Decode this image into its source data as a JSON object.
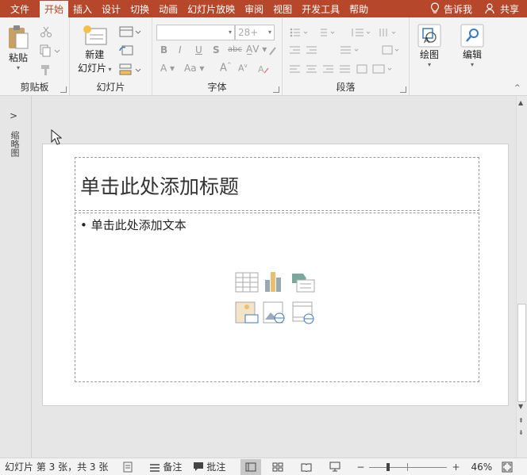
{
  "tabs": [
    {
      "label": "文件",
      "active": false
    },
    {
      "label": "开始",
      "active": true
    },
    {
      "label": "插入",
      "active": false
    },
    {
      "label": "设计",
      "active": false
    },
    {
      "label": "切换",
      "active": false
    },
    {
      "label": "动画",
      "active": false
    },
    {
      "label": "幻灯片放映",
      "active": false
    },
    {
      "label": "审阅",
      "active": false
    },
    {
      "label": "视图",
      "active": false
    },
    {
      "label": "开发工具",
      "active": false
    },
    {
      "label": "帮助",
      "active": false
    }
  ],
  "tell_me": "告诉我",
  "share": "共享",
  "ribbon": {
    "clipboard": {
      "label": "剪贴板",
      "paste": "粘贴"
    },
    "slides": {
      "label": "幻灯片",
      "new_slide_line1": "新建",
      "new_slide_line2": "幻灯片"
    },
    "font": {
      "label": "字体",
      "font_size": "28+",
      "font_name": ""
    },
    "paragraph": {
      "label": "段落"
    },
    "drawing": {
      "label": "绘图"
    },
    "editing": {
      "label": "编辑"
    }
  },
  "left_pane": {
    "label": "缩略图"
  },
  "slide": {
    "title_placeholder": "单击此处添加标题",
    "body_placeholder": "• 单击此处添加文本"
  },
  "status": {
    "slide_info": "幻灯片 第 3 张，共 3 张",
    "notes": "备注",
    "comments": "批注",
    "zoom": "46%"
  },
  "colors": {
    "accent": "#b7472a",
    "ribbon_bg": "#f3f3f3",
    "workspace_bg": "#e6e6e6"
  }
}
